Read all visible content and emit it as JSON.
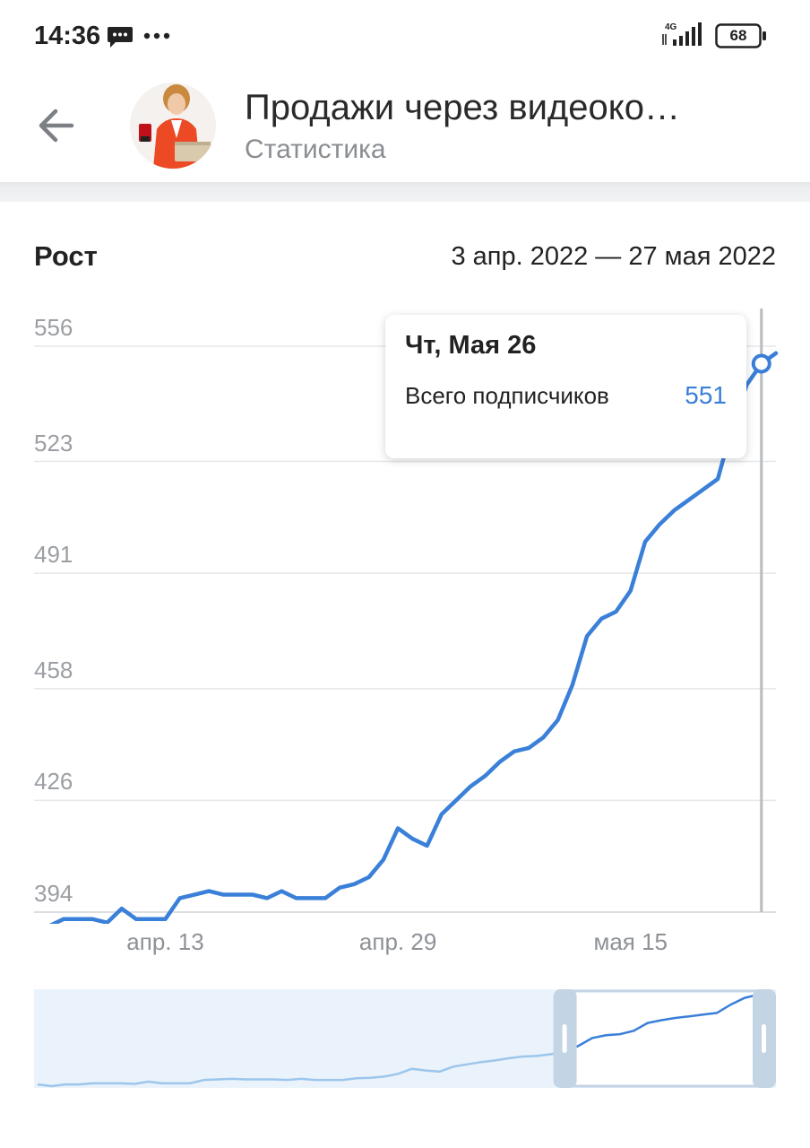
{
  "status_bar": {
    "time": "14:36",
    "network": "4G",
    "battery": "68",
    "icons": [
      "message-icon",
      "more-dots-icon",
      "signal-icon",
      "battery-icon"
    ]
  },
  "header": {
    "title": "Продажи через видеоко…",
    "subtitle": "Статистика",
    "back_icon": "arrow-left-icon"
  },
  "section": {
    "title": "Рост",
    "date_range": "3 апр. 2022 — 27 мая 2022"
  },
  "tooltip": {
    "date": "Чт, Мая 26",
    "label": "Всего подписчиков",
    "value": "551"
  },
  "colors": {
    "line": "#3a7fd8",
    "grid": "#e6e7e9",
    "navigator_bg": "#eaf3fb",
    "navigator_line": "#9cc6ec",
    "navigator_window": "#c3d4e4"
  },
  "chart_data": {
    "type": "line",
    "title": "Рост",
    "xlabel": "",
    "ylabel": "",
    "y_ticks": [
      394,
      426,
      458,
      491,
      523,
      556
    ],
    "x_ticks": [
      {
        "label": "апр. 13",
        "day": 11
      },
      {
        "label": "апр. 29",
        "day": 27
      },
      {
        "label": "мая 15",
        "day": 43
      }
    ],
    "grid": true,
    "series": [
      {
        "name": "Всего подписчиков",
        "values": [
          390,
          387,
          390,
          390,
          392,
          392,
          392,
          391,
          395,
          392,
          392,
          392,
          398,
          399,
          400,
          399,
          399,
          399,
          398,
          400,
          398,
          398,
          398,
          401,
          402,
          404,
          409,
          418,
          415,
          413,
          422,
          426,
          430,
          433,
          437,
          440,
          441,
          444,
          449,
          459,
          473,
          478,
          480,
          486,
          500,
          505,
          509,
          512,
          515,
          518,
          533,
          545,
          551,
          554
        ]
      }
    ],
    "highlight": {
      "x_label": "Чт, Мая 26",
      "value": 551
    }
  }
}
